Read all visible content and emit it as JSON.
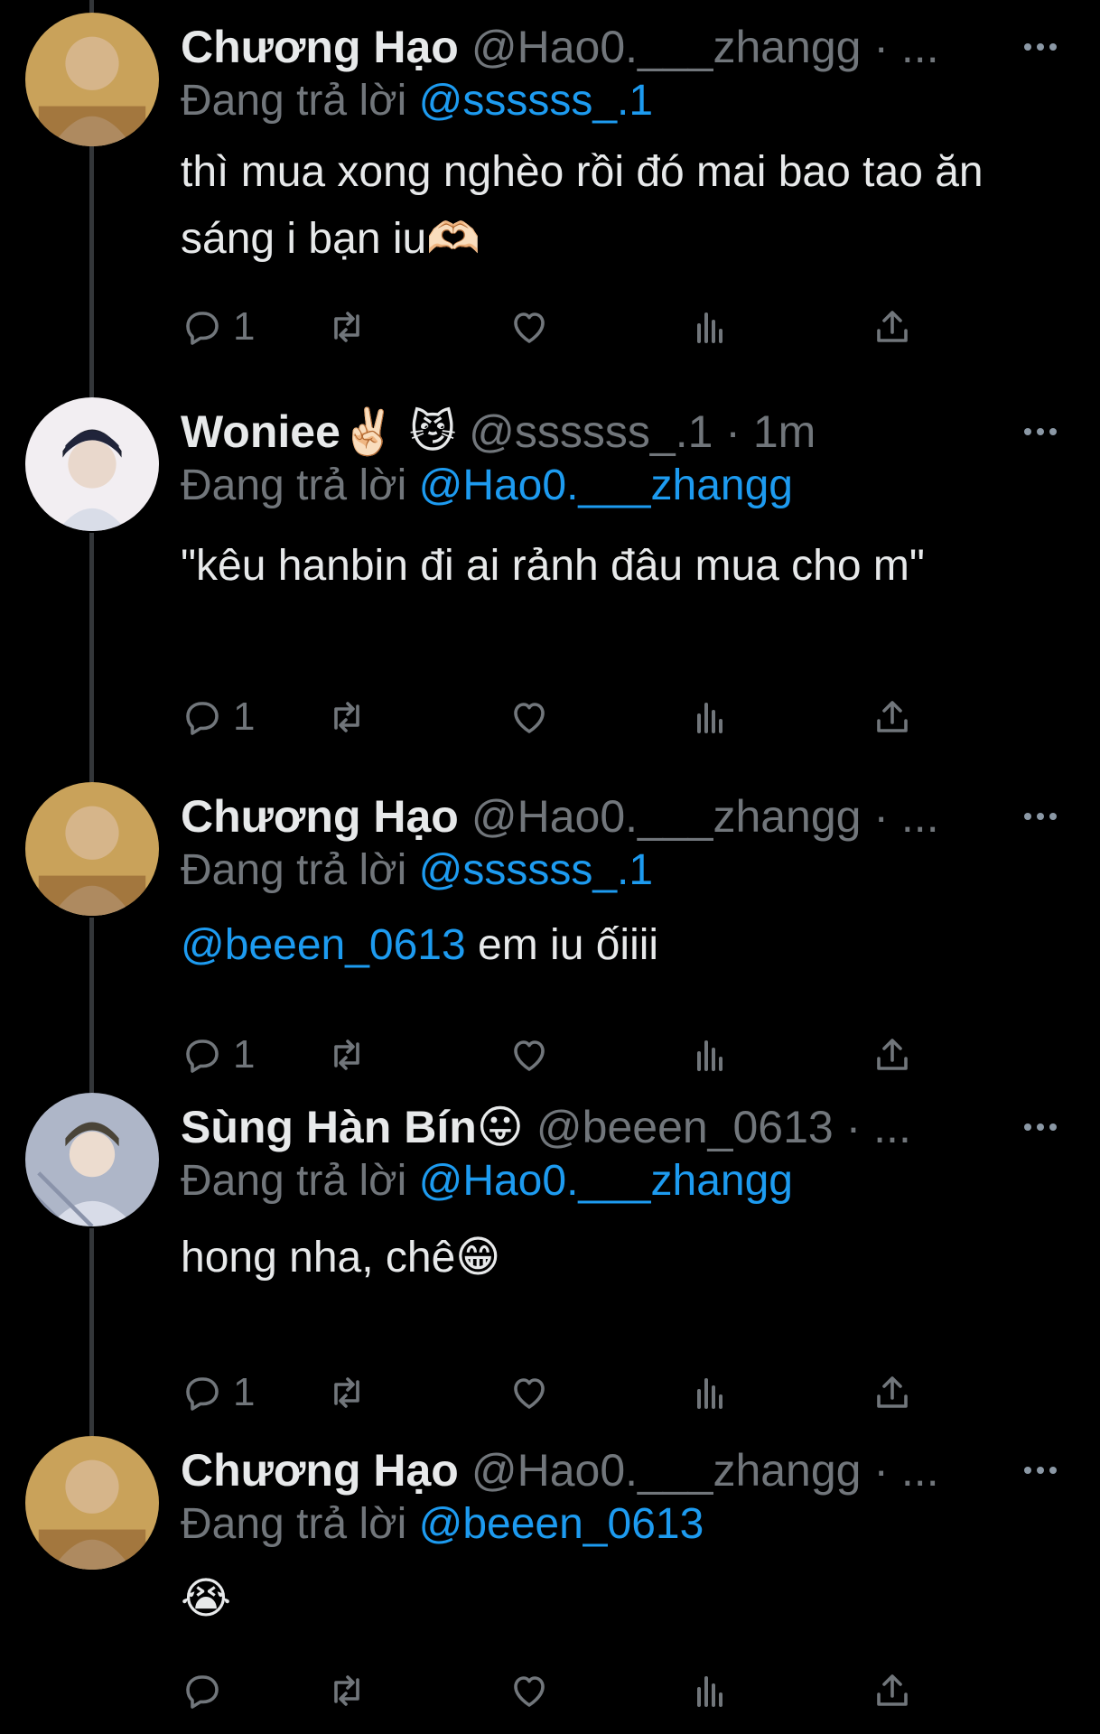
{
  "tweets": [
    {
      "name": "Chương Hạo",
      "handle": "@Hao0.___zhangg · ...",
      "replying_prefix": "Đang trả lời",
      "replying_to": "@ssssss_.1",
      "body": "thì mua xong nghèo rồi đó mai bao tao ăn sáng i bạn iu🫶🏻",
      "reply_count": "1"
    },
    {
      "name": "Woniee✌🏻 😼",
      "handle": "@ssssss_.1 · 1m",
      "replying_prefix": "Đang trả lời",
      "replying_to": "@Hao0.___zhangg",
      "body": "\"kêu hanbin đi ai rảnh đâu mua cho m\"",
      "reply_count": "1"
    },
    {
      "name": "Chương Hạo",
      "handle": "@Hao0.___zhangg · ...",
      "replying_prefix": "Đang trả lời",
      "replying_to": "@ssssss_.1",
      "body_mention": "@beeen_0613",
      "body": " em iu ốiiii",
      "reply_count": "1"
    },
    {
      "name": "Sùng Hàn Bín😛",
      "handle": "@beeen_0613 · ...",
      "replying_prefix": "Đang trả lời",
      "replying_to": "@Hao0.___zhangg",
      "body": "hong nha, chê😁",
      "reply_count": "1"
    },
    {
      "name": "Chương Hạo",
      "handle": "@Hao0.___zhangg · ...",
      "replying_prefix": "Đang trả lời",
      "replying_to": "@beeen_0613",
      "body": "😭",
      "reply_count": ""
    }
  ],
  "icons": {
    "reply": "reply-icon",
    "retweet": "retweet-icon",
    "like": "heart-icon",
    "views": "views-icon",
    "share": "share-icon",
    "more": "more-icon"
  },
  "colors": {
    "background": "#000000",
    "text": "#e7e9ea",
    "secondary": "#71767b",
    "accent": "#1d9bf0",
    "thread_line": "#333639"
  }
}
